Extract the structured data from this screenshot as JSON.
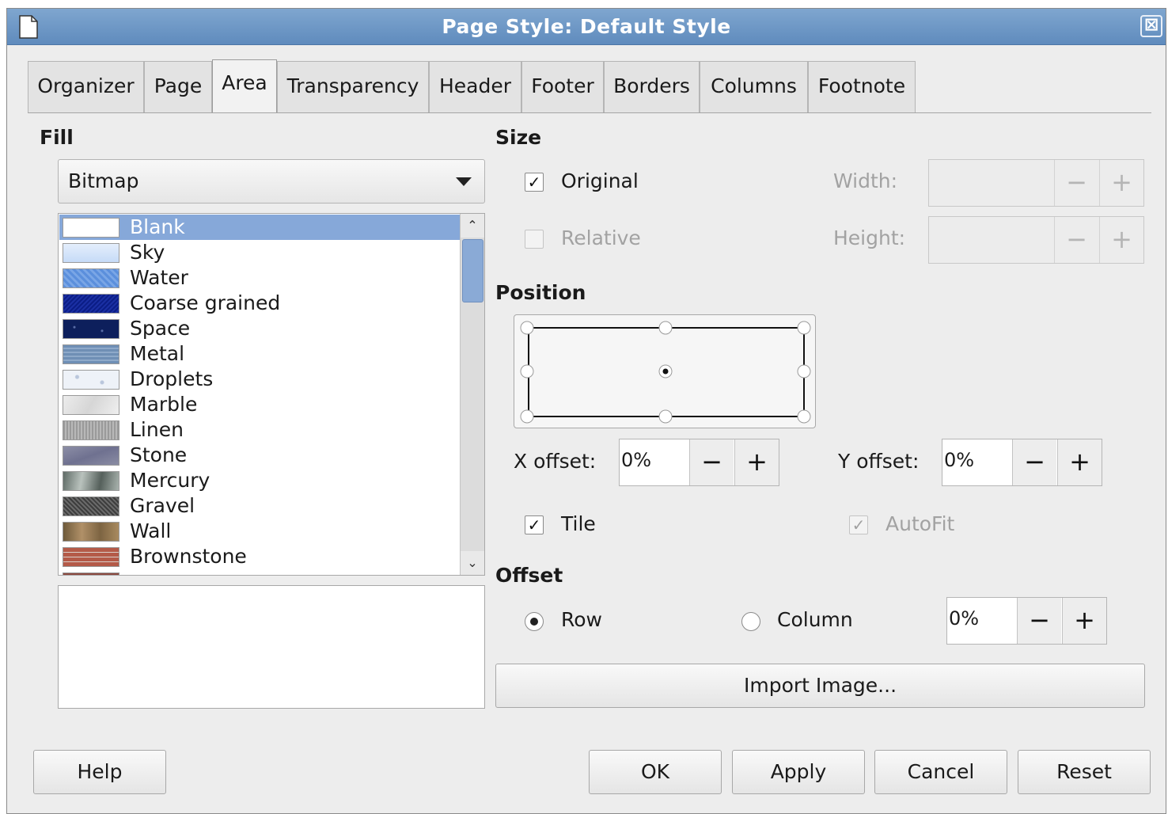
{
  "window": {
    "title": "Page Style: Default Style",
    "close_glyph": "⊠"
  },
  "tabs": [
    {
      "label": "Organizer"
    },
    {
      "label": "Page"
    },
    {
      "label": "Area",
      "active": true
    },
    {
      "label": "Transparency"
    },
    {
      "label": "Header"
    },
    {
      "label": "Footer"
    },
    {
      "label": "Borders"
    },
    {
      "label": "Columns"
    },
    {
      "label": "Footnote"
    }
  ],
  "fill": {
    "heading": "Fill",
    "type_value": "Bitmap",
    "bitmaps": [
      {
        "label": "Blank",
        "selected": true,
        "color": "#ffffff"
      },
      {
        "label": "Sky",
        "color": "#cfe2fb"
      },
      {
        "label": "Water",
        "color": "#5b8fdc"
      },
      {
        "label": "Coarse grained",
        "color": "#0b1d86"
      },
      {
        "label": "Space",
        "color": "#0d1f5c"
      },
      {
        "label": "Metal",
        "color": "#6f8fb5"
      },
      {
        "label": "Droplets",
        "color": "#e8edf6"
      },
      {
        "label": "Marble",
        "color": "#e2e2e2"
      },
      {
        "label": "Linen",
        "color": "#a8a8a8"
      },
      {
        "label": "Stone",
        "color": "#7f8198"
      },
      {
        "label": "Mercury",
        "color": "#8a9590"
      },
      {
        "label": "Gravel",
        "color": "#4d4d4d"
      },
      {
        "label": "Wall",
        "color": "#8f7450"
      },
      {
        "label": "Brownstone",
        "color": "#b45a48"
      },
      {
        "label": "",
        "color": "#8c4a40"
      }
    ],
    "scroll_up_glyph": "⌃",
    "scroll_down_glyph": "⌄"
  },
  "size": {
    "heading": "Size",
    "original_label": "Original",
    "original_checked": true,
    "relative_label": "Relative",
    "relative_checked": false,
    "width_label": "Width:",
    "height_label": "Height:"
  },
  "position": {
    "heading": "Position",
    "x_offset_label": "X offset:",
    "x_offset_value": "0%",
    "y_offset_label": "Y offset:",
    "y_offset_value": "0%",
    "tile_label": "Tile",
    "tile_checked": true,
    "autofit_label": "AutoFit",
    "autofit_checked": true
  },
  "offset": {
    "heading": "Offset",
    "row_label": "Row",
    "column_label": "Column",
    "selected": "Row",
    "value": "0%"
  },
  "spin": {
    "minus": "−",
    "plus": "+"
  },
  "check_glyph": "✓",
  "import_image_label": "Import Image...",
  "buttons": {
    "help": "Help",
    "ok": "OK",
    "apply": "Apply",
    "cancel": "Cancel",
    "reset": "Reset"
  }
}
